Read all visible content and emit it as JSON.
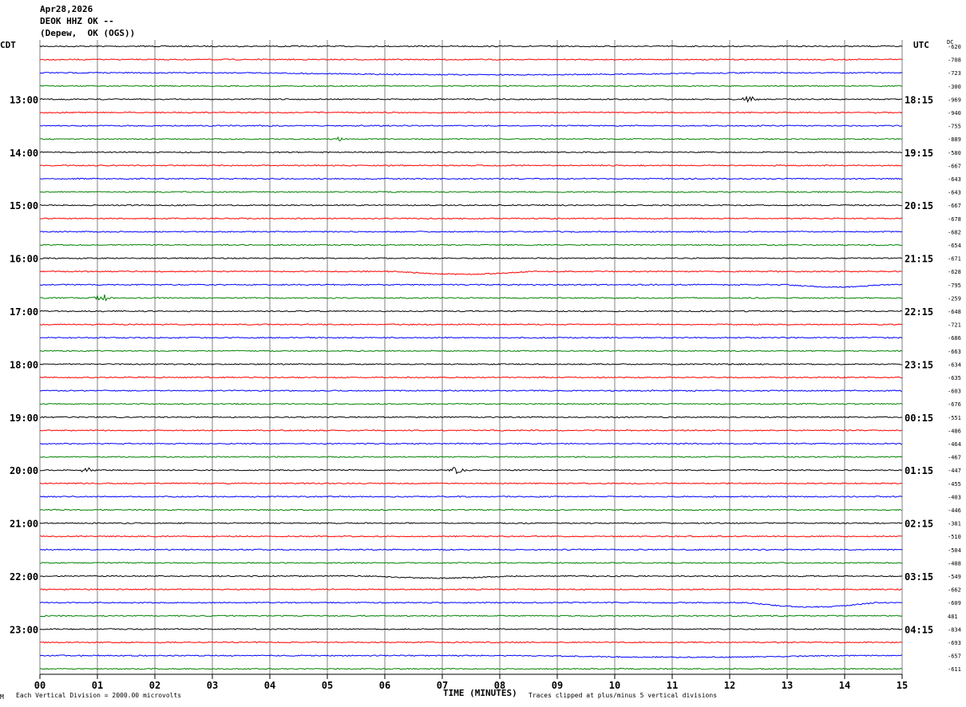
{
  "header": {
    "date": "Apr28,2026",
    "station": "DEOK HHZ OK --",
    "location": "(Depew,  OK (OGS))"
  },
  "left_title": "CDT",
  "right_title": "UTC",
  "dc_label": "DC",
  "footer": {
    "division_note": "Each Vertical Division = 2000.00 microvolts",
    "xlabel": "TIME (MINUTES)",
    "clip_note": "Traces clipped at plus/minus 5 vertical divisions",
    "corner_mark": "M"
  },
  "colors": {
    "trace_cycle": [
      "#000000",
      "#ff0000",
      "#0000ff",
      "#008000"
    ],
    "grid_vertical": "#808080",
    "background": "#ffffff"
  },
  "chart_data": {
    "type": "line",
    "title": "DEOK HHZ OK --",
    "xlabel": "TIME (MINUTES)",
    "xlim": [
      0,
      15
    ],
    "x_ticks": [
      "00",
      "01",
      "02",
      "03",
      "04",
      "05",
      "06",
      "07",
      "08",
      "09",
      "10",
      "11",
      "12",
      "13",
      "14",
      "15"
    ],
    "traces_per_hour": 4,
    "left_hour_labels": [
      "13:00",
      "14:00",
      "15:00",
      "16:00",
      "17:00",
      "18:00",
      "19:00",
      "20:00",
      "21:00",
      "22:00",
      "23:00"
    ],
    "right_hour_labels": [
      "18:15",
      "19:15",
      "20:15",
      "21:15",
      "22:15",
      "23:15",
      "00:15",
      "01:15",
      "02:15",
      "03:15",
      "04:15"
    ],
    "dc_offsets": [
      "-620",
      "-708",
      "-723",
      "-300",
      "-969",
      "-940",
      "-755",
      "-889",
      "-580",
      "-667",
      "-643",
      "-643",
      "-667",
      "-678",
      "-682",
      "-654",
      "-671",
      "-628",
      "-795",
      "-259",
      "-648",
      "-721",
      "-686",
      "-663",
      "-634",
      "-635",
      "-603",
      "-676",
      "-551",
      "-486",
      "-464",
      "-467",
      "-447",
      "-455",
      "-403",
      "-446",
      "-381",
      "-510",
      "-504",
      "-488",
      "-549",
      "-662",
      "-609",
      "481",
      "-834",
      "-693",
      "-657",
      "-611"
    ],
    "events": [
      {
        "trace": 4,
        "minute": 12.35,
        "amplitude": 1.0
      },
      {
        "trace": 7,
        "minute": 5.2,
        "amplitude": 0.4
      },
      {
        "trace": 19,
        "minute": 1.1,
        "amplitude": 1.5
      },
      {
        "trace": 32,
        "minute": 0.8,
        "amplitude": 0.9
      },
      {
        "trace": 32,
        "minute": 7.25,
        "amplitude": 1.0
      }
    ],
    "drifts": [
      {
        "trace": 2,
        "from_minute": 3.7,
        "to_minute": 14.0,
        "level": 0.25
      },
      {
        "trace": 17,
        "from_minute": 6.2,
        "to_minute": 9.0,
        "level": 0.35
      },
      {
        "trace": 18,
        "from_minute": 13.0,
        "to_minute": 15.0,
        "level": 0.3
      },
      {
        "trace": 40,
        "from_minute": 5.8,
        "to_minute": 8.6,
        "level": 0.25
      },
      {
        "trace": 42,
        "from_minute": 12.3,
        "to_minute": 15.0,
        "level": 0.55
      },
      {
        "trace": 46,
        "from_minute": 8.5,
        "to_minute": 15.0,
        "level": 0.2
      }
    ]
  }
}
